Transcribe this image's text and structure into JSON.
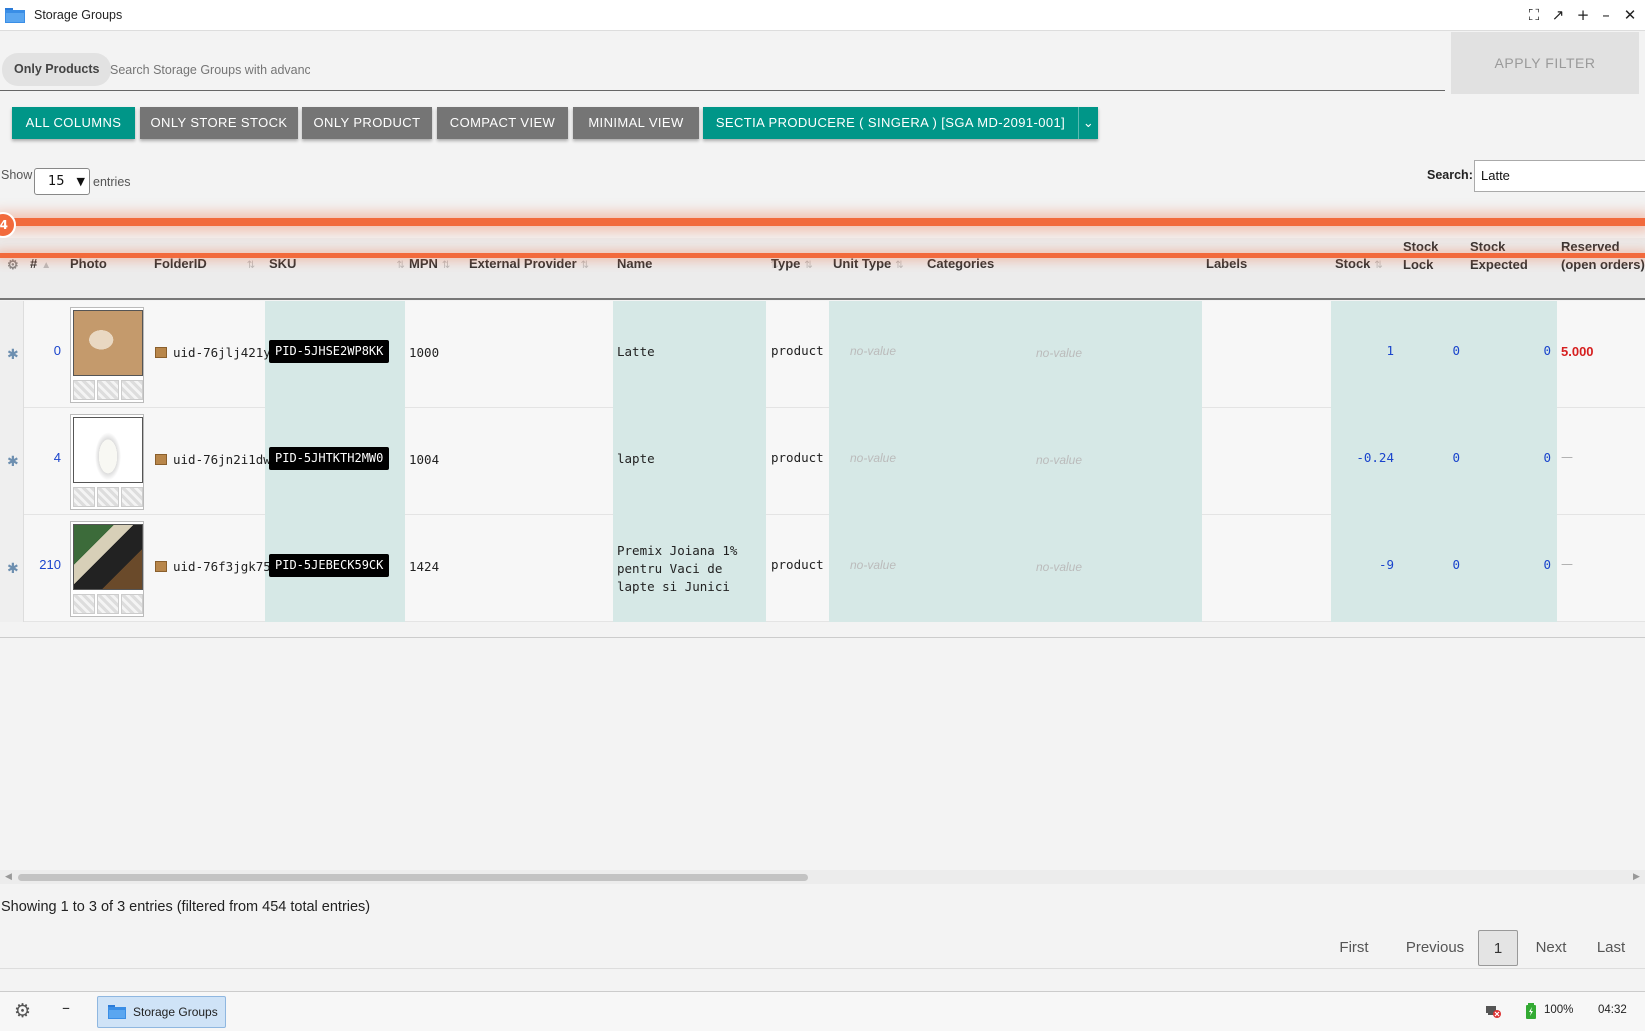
{
  "window": {
    "title": "Storage Groups"
  },
  "filter": {
    "chip_label": "Only Products",
    "search_placeholder": "Search Storage Groups with advanced filters",
    "apply_label": "APPLY FILTER"
  },
  "toolbar": {
    "all_columns": "ALL COLUMNS",
    "only_store_stock": "ONLY STORE STOCK",
    "only_product": "ONLY PRODUCT",
    "compact_view": "COMPACT VIEW",
    "minimal_view": "MINIMAL VIEW",
    "store_select": "SECTIA PRODUCERE ( SINGERA ) [SGA MD-2091-001]"
  },
  "table_controls": {
    "show_label": "Show",
    "entries_value": "15",
    "entries_label": "entries",
    "search_label": "Search:",
    "search_value": "Latte"
  },
  "overlay": {
    "badge": "4"
  },
  "columns": {
    "num": "#",
    "photo": "Photo",
    "folder": "FolderID",
    "sku": "SKU",
    "mpn": "MPN",
    "provider": "External Provider",
    "name": "Name",
    "type": "Type",
    "unit": "Unit Type",
    "categories": "Categories",
    "labels": "Labels",
    "stock": "Stock",
    "stock_lock_1": "Stock",
    "stock_lock_2": "Lock",
    "stock_exp_1": "Stock",
    "stock_exp_2": "Expected",
    "reserved_1": "Reserved",
    "reserved_2": "(open orders)"
  },
  "rows": [
    {
      "idx": "0",
      "folder": "uid-76jlj421y",
      "sku": "PID-5JHSE2WP8KK",
      "mpn": "1000",
      "name": "Latte",
      "type": "product",
      "unit": "no-value",
      "categories": "no-value",
      "stock": "1",
      "lock": "0",
      "expected": "0",
      "reserved": "5.000"
    },
    {
      "idx": "4",
      "folder": "uid-76jn2i1dw",
      "sku": "PID-5JHTKTH2MW0",
      "mpn": "1004",
      "name": "lapte",
      "type": "product",
      "unit": "no-value",
      "categories": "no-value",
      "stock": "-0.24",
      "lock": "0",
      "expected": "0",
      "reserved": "—"
    },
    {
      "idx": "210",
      "folder": "uid-76f3jgk75",
      "sku": "PID-5JEBECK59CK",
      "mpn": "1424",
      "name": "Premix Joiana 1% pentru Vaci de lapte si Junici",
      "type": "product",
      "unit": "no-value",
      "categories": "no-value",
      "stock": "-9",
      "lock": "0",
      "expected": "0",
      "reserved": "—"
    }
  ],
  "footer": {
    "info": "Showing 1 to 3 of 3 entries (filtered from 454 total entries)",
    "first": "First",
    "previous": "Previous",
    "page": "1",
    "next": "Next",
    "last": "Last"
  },
  "taskbar": {
    "task_label": "Storage Groups",
    "battery": "100%",
    "clock": "04:32"
  },
  "colors": {
    "accent_teal": "#009688",
    "button_grey": "#757575",
    "highlight_orange": "#f26a3c",
    "reserved_red": "#d62020"
  }
}
